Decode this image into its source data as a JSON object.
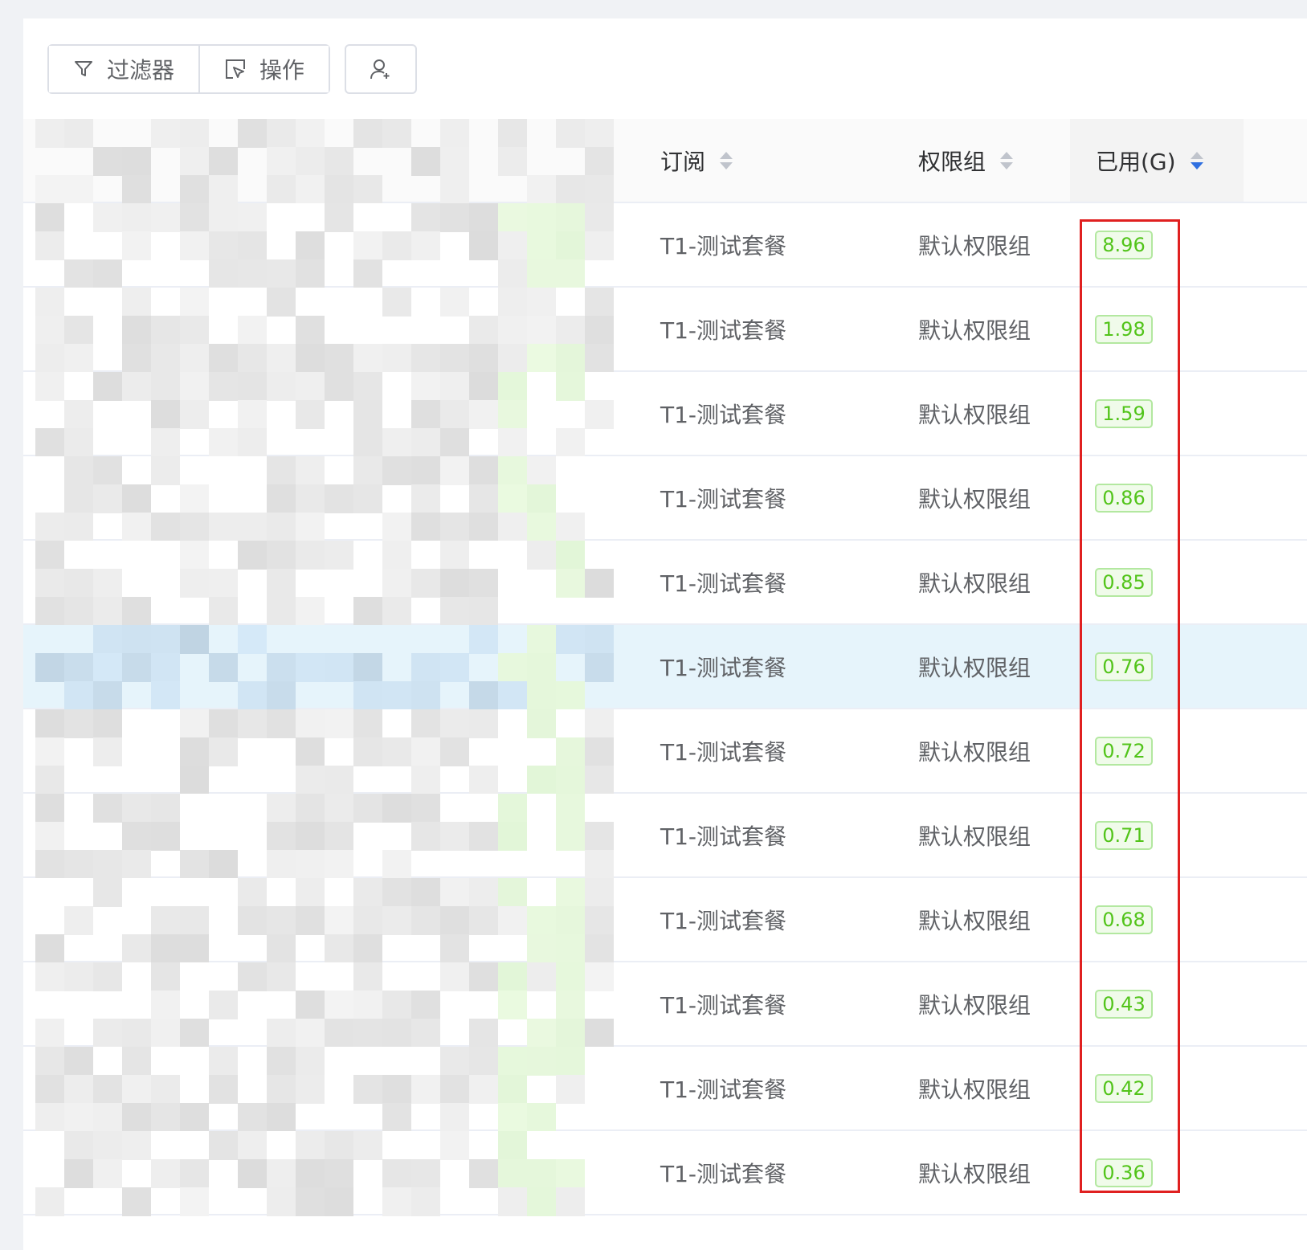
{
  "toolbar": {
    "filter_label": "过滤器",
    "action_label": "操作"
  },
  "table": {
    "columns": {
      "subscription": "订阅",
      "permission_group": "权限组",
      "used": "已用(G)"
    },
    "rows": [
      {
        "subscription": "T1-测试套餐",
        "permission_group": "默认权限组",
        "used": "8.96"
      },
      {
        "subscription": "T1-测试套餐",
        "permission_group": "默认权限组",
        "used": "1.98"
      },
      {
        "subscription": "T1-测试套餐",
        "permission_group": "默认权限组",
        "used": "1.59"
      },
      {
        "subscription": "T1-测试套餐",
        "permission_group": "默认权限组",
        "used": "0.86"
      },
      {
        "subscription": "T1-测试套餐",
        "permission_group": "默认权限组",
        "used": "0.85"
      },
      {
        "subscription": "T1-测试套餐",
        "permission_group": "默认权限组",
        "used": "0.76"
      },
      {
        "subscription": "T1-测试套餐",
        "permission_group": "默认权限组",
        "used": "0.72"
      },
      {
        "subscription": "T1-测试套餐",
        "permission_group": "默认权限组",
        "used": "0.71"
      },
      {
        "subscription": "T1-测试套餐",
        "permission_group": "默认权限组",
        "used": "0.68"
      },
      {
        "subscription": "T1-测试套餐",
        "permission_group": "默认权限组",
        "used": "0.43"
      },
      {
        "subscription": "T1-测试套餐",
        "permission_group": "默认权限组",
        "used": "0.42"
      },
      {
        "subscription": "T1-测试套餐",
        "permission_group": "默认权限组",
        "used": "0.36"
      }
    ]
  },
  "colors": {
    "tag_text": "#52c41a",
    "tag_border": "#b3e8a0",
    "sort_active": "#2f6fe0",
    "highlight_box": "#e02020",
    "hover_row": "#e6f4fb"
  },
  "icons": [
    "filter-icon",
    "cursor-select-icon",
    "user-add-icon",
    "sort-caret-icon"
  ]
}
